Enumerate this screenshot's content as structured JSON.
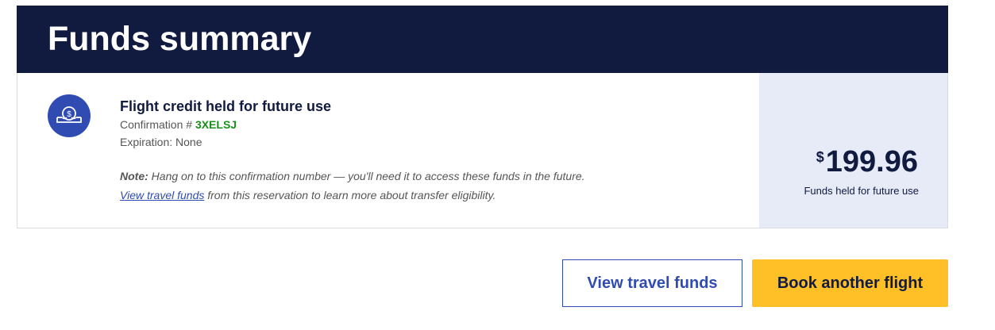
{
  "header": {
    "title": "Funds summary"
  },
  "credit": {
    "icon": "money-hand-icon",
    "title": "Flight credit held for future use",
    "confirmation_label": "Confirmation #",
    "confirmation_code": "3XELSJ",
    "expiration_text": "Expiration: None",
    "note_label": "Note:",
    "note_text": "Hang on to this confirmation number — you'll need it to access these funds in the future.",
    "link_text": "View travel funds",
    "link_suffix": "from this reservation to learn more about transfer eligibility."
  },
  "amount": {
    "currency": "$",
    "value": "199.96",
    "label": "Funds held for future use"
  },
  "actions": {
    "view_funds_label": "View travel funds",
    "book_flight_label": "Book another flight"
  },
  "colors": {
    "header_bg": "#111b40",
    "accent_blue": "#304cb2",
    "confirmation_green": "#1a8f1a",
    "primary_button": "#ffbf27",
    "amount_panel_bg": "#e6ebf7"
  }
}
